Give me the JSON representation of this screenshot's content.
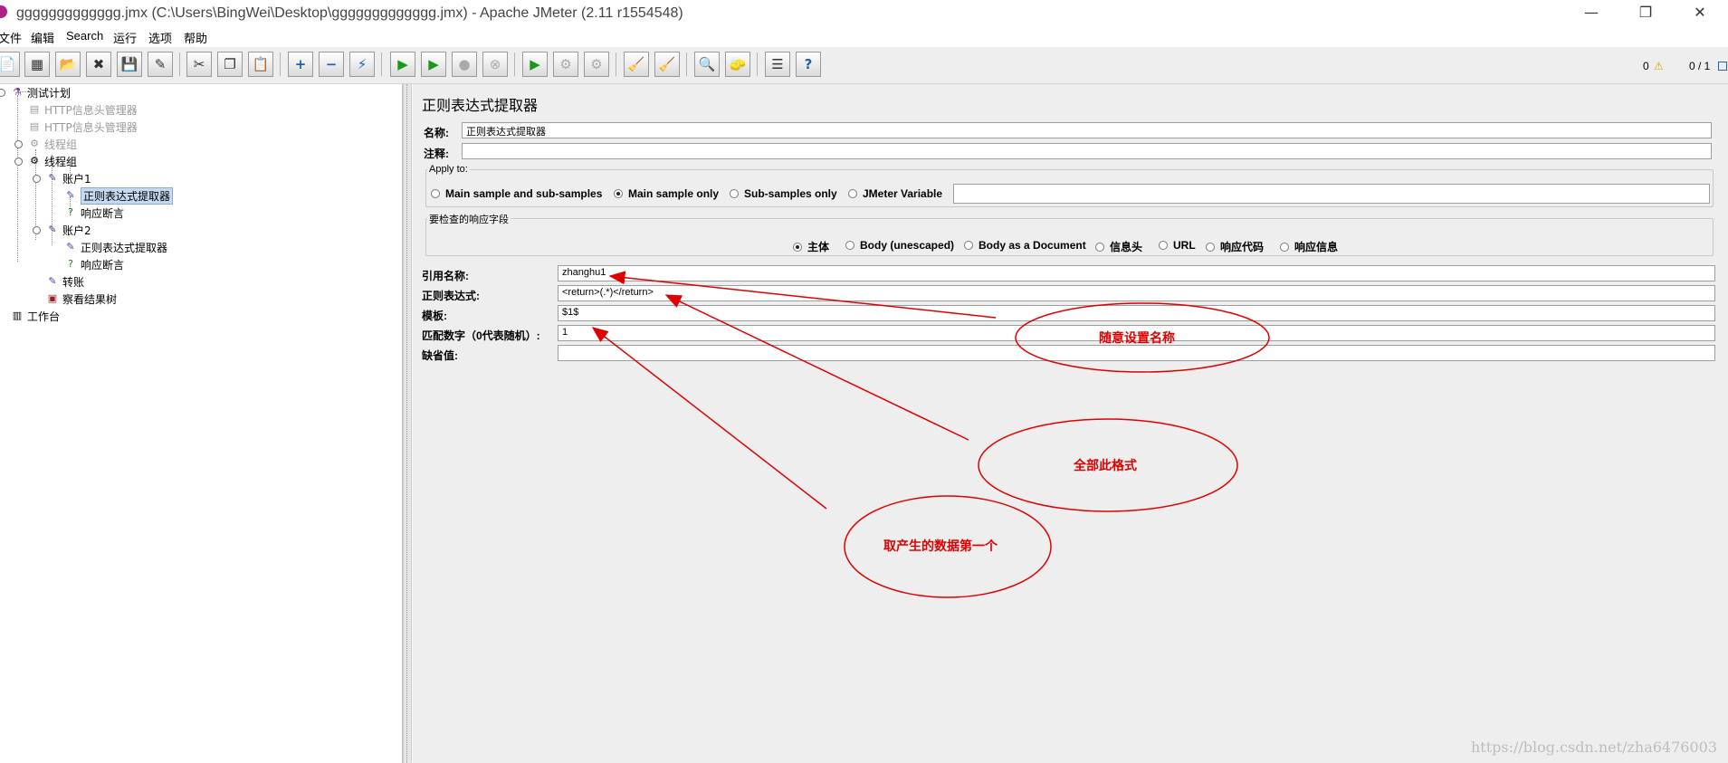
{
  "window": {
    "title": "ggggggggggggg.jmx (C:\\Users\\BingWei\\Desktop\\ggggggggggggg.jmx) - Apache JMeter (2.11 r1554548)",
    "minimize": "—",
    "restore": "❐",
    "close": "✕"
  },
  "menu": [
    "文件",
    "编辑",
    "Search",
    "运行",
    "选项",
    "帮助"
  ],
  "toolbar": {
    "warning_count": "0",
    "thread_count": "0 / 1",
    "icons": [
      "new-icon",
      "templates-icon",
      "open-icon",
      "close-file-icon",
      "save-icon",
      "save-as-icon",
      "cut-icon",
      "copy-icon",
      "paste-icon",
      "expand-icon",
      "collapse-icon",
      "toggle-icon",
      "start-icon",
      "start-no-timers-icon",
      "stop-icon",
      "shutdown-icon",
      "remote-start-icon",
      "remote-stop-icon",
      "remote-shutdown-icon",
      "clear-icon",
      "clear-all-icon",
      "search-icon",
      "reset-search-icon",
      "function-helper-icon",
      "help-icon"
    ]
  },
  "tree": [
    {
      "label": "测试计划",
      "disabled": false
    },
    {
      "label": "HTTP信息头管理器",
      "disabled": true
    },
    {
      "label": "HTTP信息头管理器",
      "disabled": true
    },
    {
      "label": "线程组",
      "disabled": true
    },
    {
      "label": "线程组",
      "disabled": false
    },
    {
      "label": "账户1",
      "disabled": false
    },
    {
      "label": "正则表达式提取器",
      "disabled": false,
      "selected": true
    },
    {
      "label": "响应断言",
      "disabled": false
    },
    {
      "label": "账户2",
      "disabled": false
    },
    {
      "label": "正则表达式提取器",
      "disabled": false
    },
    {
      "label": "响应断言",
      "disabled": false
    },
    {
      "label": "转账",
      "disabled": false
    },
    {
      "label": "察看结果树",
      "disabled": false
    },
    {
      "label": "工作台",
      "disabled": false
    }
  ],
  "panel": {
    "title": "正则表达式提取器",
    "name_label": "名称:",
    "name_value": "正则表达式提取器",
    "comment_label": "注释:",
    "comment_value": "",
    "apply_to": {
      "title": "Apply to:",
      "options": [
        "Main sample and sub-samples",
        "Main sample only",
        "Sub-samples only",
        "JMeter Variable"
      ],
      "selected": 1,
      "variable_value": ""
    },
    "field_to_check": {
      "title": "要检查的响应字段",
      "options": [
        "主体",
        "Body (unescaped)",
        "Body as a Document",
        "信息头",
        "URL",
        "响应代码",
        "响应信息"
      ],
      "selected": 0
    },
    "fields": [
      {
        "label": "引用名称:",
        "value": "zhanghu1"
      },
      {
        "label": "正则表达式:",
        "value": "<return>(.*)</return>"
      },
      {
        "label": "模板:",
        "value": "$1$"
      },
      {
        "label": "匹配数字（0代表随机）:",
        "value": "1"
      },
      {
        "label": "缺省值:",
        "value": ""
      }
    ]
  },
  "annotations": {
    "note1": "随意设置名称",
    "note2": "全部此格式",
    "note3": "取产生的数据第一个",
    "color": "#e00000"
  },
  "watermark": "https://blog.csdn.net/zha6476003"
}
